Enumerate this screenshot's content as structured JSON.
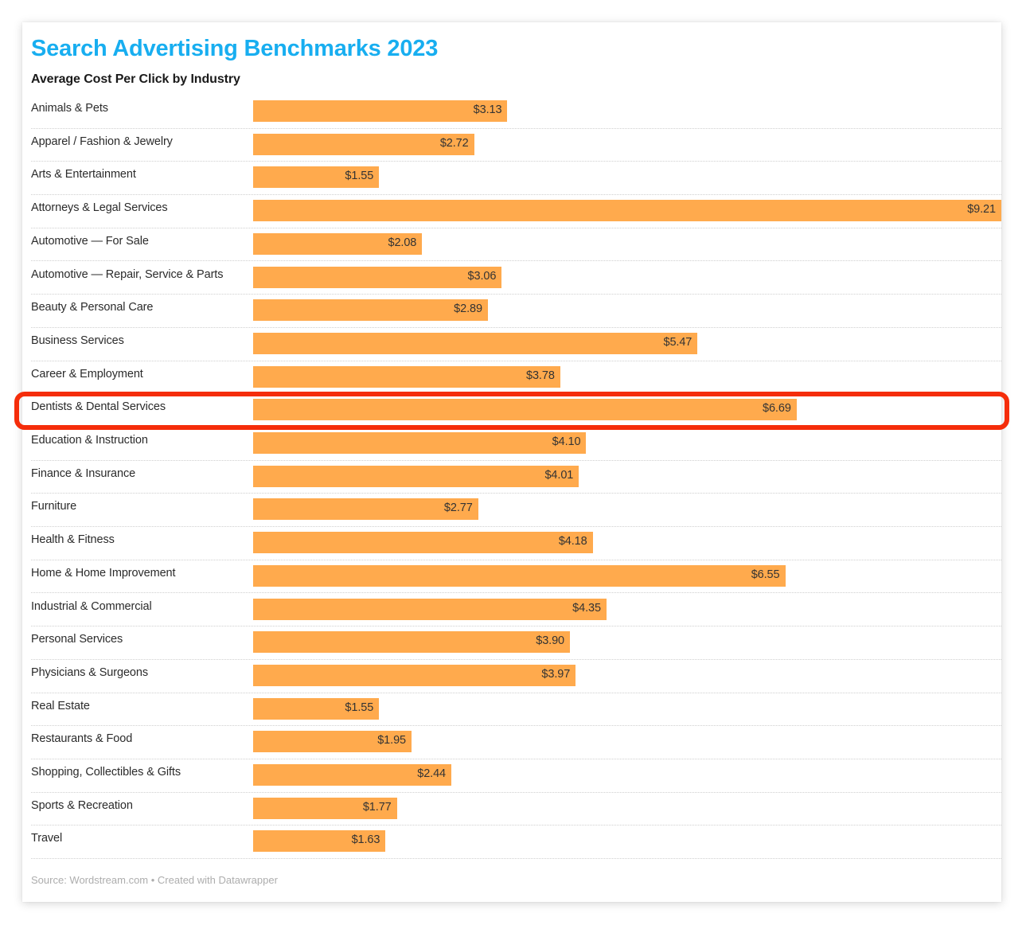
{
  "header": {
    "title": "Search Advertising Benchmarks 2023",
    "subtitle": "Average Cost Per Click by Industry"
  },
  "footer": {
    "text": "Source: Wordstream.com • Created with Datawrapper"
  },
  "annotation": {
    "highlighted_category": "Dentists & Dental Services",
    "color": "#F52D0A"
  },
  "style": {
    "bar_color": "#FFAA4D",
    "title_color": "#18AEF0",
    "label_color": "#2b2b2b",
    "value_color": "#333333",
    "footer_color": "#adadad"
  },
  "chart_data": {
    "type": "bar",
    "orientation": "horizontal",
    "title": "Search Advertising Benchmarks 2023",
    "subtitle": "Average Cost Per Click by Industry",
    "xlabel": "",
    "ylabel": "",
    "xlim": [
      0,
      9.21
    ],
    "grid": false,
    "legend": "none",
    "value_prefix": "$",
    "categories": [
      "Animals & Pets",
      "Apparel / Fashion & Jewelry",
      "Arts & Entertainment",
      "Attorneys & Legal Services",
      "Automotive — For Sale",
      "Automotive — Repair, Service & Parts",
      "Beauty & Personal Care",
      "Business Services",
      "Career & Employment",
      "Dentists & Dental Services",
      "Education & Instruction",
      "Finance & Insurance",
      "Furniture",
      "Health & Fitness",
      "Home & Home Improvement",
      "Industrial & Commercial",
      "Personal Services",
      "Physicians & Surgeons",
      "Real Estate",
      "Restaurants & Food",
      "Shopping, Collectibles & Gifts",
      "Sports & Recreation",
      "Travel"
    ],
    "values": [
      3.13,
      2.72,
      1.55,
      9.21,
      2.08,
      3.06,
      2.89,
      5.47,
      3.78,
      6.69,
      4.1,
      4.01,
      2.77,
      4.18,
      6.55,
      4.35,
      3.9,
      3.97,
      1.55,
      1.95,
      2.44,
      1.77,
      1.63
    ],
    "value_labels": [
      "$3.13",
      "$2.72",
      "$1.55",
      "$9.21",
      "$2.08",
      "$3.06",
      "$2.89",
      "$5.47",
      "$3.78",
      "$6.69",
      "$4.10",
      "$4.01",
      "$2.77",
      "$4.18",
      "$6.55",
      "$4.35",
      "$3.90",
      "$3.97",
      "$1.55",
      "$1.95",
      "$2.44",
      "$1.77",
      "$1.63"
    ]
  }
}
